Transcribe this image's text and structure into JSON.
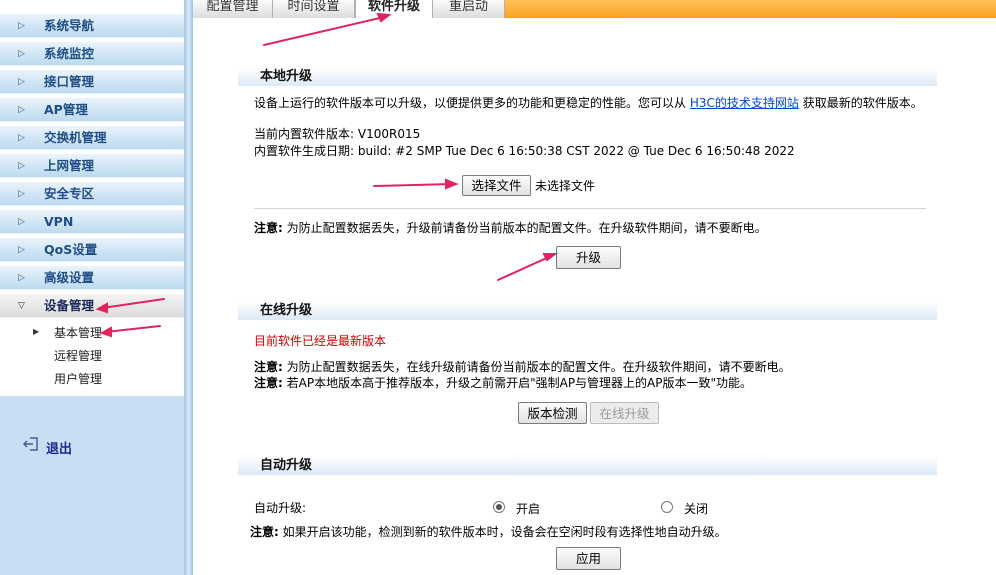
{
  "sidebar": {
    "items": [
      {
        "label": "系统导航"
      },
      {
        "label": "系统监控"
      },
      {
        "label": "接口管理"
      },
      {
        "label": "AP管理"
      },
      {
        "label": "交换机管理"
      },
      {
        "label": "上网管理"
      },
      {
        "label": "安全专区"
      },
      {
        "label": "VPN"
      },
      {
        "label": "QoS设置"
      },
      {
        "label": "高级设置"
      },
      {
        "label": "设备管理"
      }
    ],
    "sub_items": [
      {
        "label": "基本管理"
      },
      {
        "label": "远程管理"
      },
      {
        "label": "用户管理"
      }
    ],
    "logout": "退出"
  },
  "tabs": [
    {
      "label": "配置管理"
    },
    {
      "label": "时间设置"
    },
    {
      "label": "软件升级"
    },
    {
      "label": "重启动"
    }
  ],
  "local_upgrade": {
    "title": "本地升级",
    "intro_prefix": "设备上运行的软件版本可以升级，以便提供更多的功能和更稳定的性能。您可以从",
    "intro_link": "H3C的技术支持网站",
    "intro_suffix": "获取最新的软件版本。",
    "current_version_label": "当前内置软件版本:",
    "current_version_value": "V100R015",
    "build_date_label": "内置软件生成日期:",
    "build_date_value": "build: #2 SMP Tue Dec 6 16:50:38 CST 2022 @ Tue Dec 6 16:50:48 2022",
    "choose_file_button": "选择文件",
    "no_file_text": "未选择文件",
    "note_label": "注意:",
    "note_text": "为防止配置数据丢失，升级前请备份当前版本的配置文件。在升级软件期间，请不要断电。",
    "upgrade_button": "升级"
  },
  "online_upgrade": {
    "title": "在线升级",
    "status": "目前软件已经是最新版本",
    "note1_label": "注意:",
    "note1_text": "为防止配置数据丢失，在线升级前请备份当前版本的配置文件。在升级软件期间，请不要断电。",
    "note2_label": "注意:",
    "note2_text": "若AP本地版本高于推荐版本，升级之前需开启\"强制AP与管理器上的AP版本一致\"功能。",
    "check_button": "版本检测",
    "online_button": "在线升级"
  },
  "auto_upgrade": {
    "title": "自动升级",
    "label": "自动升级:",
    "on_label": "开启",
    "off_label": "关闭",
    "selected": "on",
    "note_label": "注意:",
    "note_text": "如果开启该功能，检测到新的软件版本时，设备会在空闲时段有选择性地自动升级。",
    "apply_button": "应用"
  },
  "colors": {
    "tabbar_accent": "#f9a21f",
    "nav_text": "#1f4e86",
    "annotation_arrow": "#e0245e",
    "status_red": "#d40000"
  }
}
